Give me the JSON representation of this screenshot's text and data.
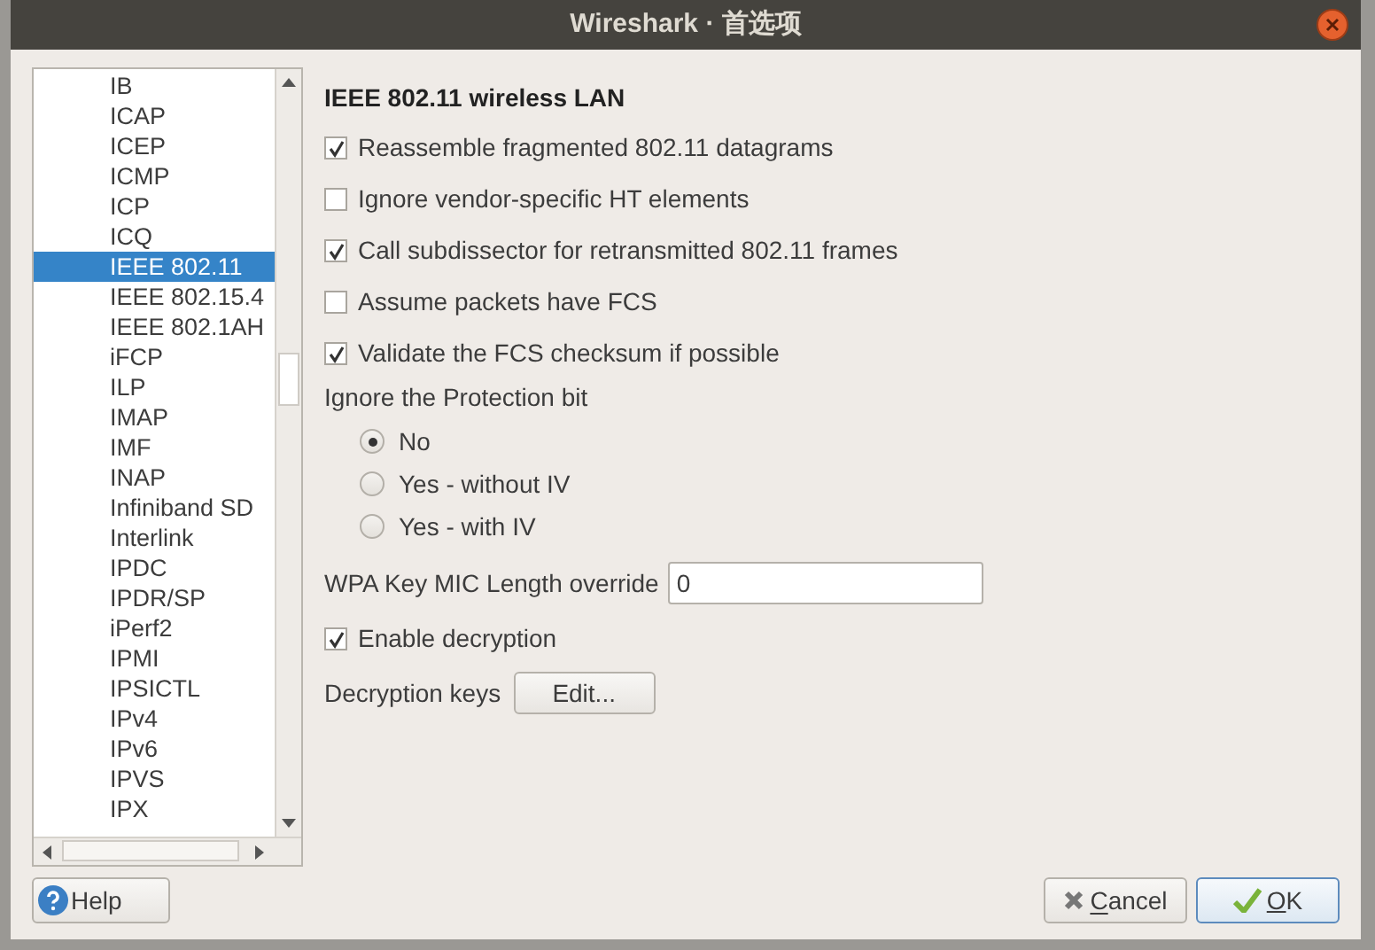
{
  "window": {
    "title": "Wireshark · 首选项"
  },
  "sidebar": {
    "items": [
      {
        "label": "IB",
        "selected": false
      },
      {
        "label": "ICAP",
        "selected": false
      },
      {
        "label": "ICEP",
        "selected": false
      },
      {
        "label": "ICMP",
        "selected": false
      },
      {
        "label": "ICP",
        "selected": false
      },
      {
        "label": "ICQ",
        "selected": false
      },
      {
        "label": "IEEE 802.11",
        "selected": true
      },
      {
        "label": "IEEE 802.15.4",
        "selected": false
      },
      {
        "label": "IEEE 802.1AH",
        "selected": false
      },
      {
        "label": "iFCP",
        "selected": false
      },
      {
        "label": "ILP",
        "selected": false
      },
      {
        "label": "IMAP",
        "selected": false
      },
      {
        "label": "IMF",
        "selected": false
      },
      {
        "label": "INAP",
        "selected": false
      },
      {
        "label": "Infiniband SD",
        "selected": false
      },
      {
        "label": "Interlink",
        "selected": false
      },
      {
        "label": "IPDC",
        "selected": false
      },
      {
        "label": "IPDR/SP",
        "selected": false
      },
      {
        "label": "iPerf2",
        "selected": false
      },
      {
        "label": "IPMI",
        "selected": false
      },
      {
        "label": "IPSICTL",
        "selected": false
      },
      {
        "label": "IPv4",
        "selected": false
      },
      {
        "label": "IPv6",
        "selected": false
      },
      {
        "label": "IPVS",
        "selected": false
      },
      {
        "label": "IPX",
        "selected": false
      }
    ]
  },
  "panel": {
    "title": "IEEE 802.11 wireless LAN",
    "options": [
      {
        "kind": "checkbox",
        "label": "Reassemble fragmented 802.11 datagrams",
        "checked": true
      },
      {
        "kind": "checkbox",
        "label": "Ignore vendor-specific HT elements",
        "checked": false
      },
      {
        "kind": "checkbox",
        "label": "Call subdissector for retransmitted 802.11 frames",
        "checked": true
      },
      {
        "kind": "checkbox",
        "label": "Assume packets have FCS",
        "checked": false
      },
      {
        "kind": "checkbox",
        "label": "Validate the FCS checksum if possible",
        "checked": true
      },
      {
        "kind": "radio_group",
        "label": "Ignore the Protection bit",
        "choices": [
          {
            "label": "No",
            "selected": true
          },
          {
            "label": "Yes - without IV",
            "selected": false
          },
          {
            "label": "Yes - with IV",
            "selected": false
          }
        ]
      },
      {
        "kind": "text_field",
        "label": "WPA Key MIC Length override",
        "value": "0"
      },
      {
        "kind": "checkbox",
        "label": "Enable decryption",
        "checked": true
      },
      {
        "kind": "button_row",
        "label": "Decryption keys",
        "button": "Edit..."
      }
    ]
  },
  "buttons": {
    "help": "Help",
    "cancel": "Cancel",
    "ok": "OK"
  }
}
